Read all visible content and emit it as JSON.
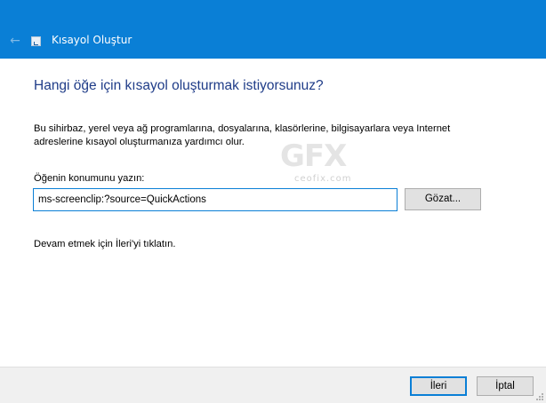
{
  "window": {
    "title": "Kısayol Oluştur",
    "accent_color": "#0a7fd6",
    "back_icon": "back-arrow-icon",
    "app_icon": "shortcut-icon"
  },
  "main": {
    "heading": "Hangi öğe için kısayol oluşturmak istiyorsunuz?",
    "description": "Bu sihirbaz, yerel veya ağ programlarına, dosyalarına, klasörlerine, bilgisayarlara veya Internet adreslerine kısayol oluşturmanıza yardımcı olur.",
    "location_label_prefix": "Ö",
    "location_label_underlined": "ğ",
    "location_label_suffix": "enin konumunu yazın:",
    "location_value": "ms-screenclip:?source=QuickActions",
    "browse_label": "Gözat...",
    "hint": "Devam etmek için İleri'yi tıklatın."
  },
  "watermark": {
    "logo": "GFX",
    "site": "ceofix.com"
  },
  "footer": {
    "next_label": "İleri",
    "cancel_label": "İptal"
  }
}
